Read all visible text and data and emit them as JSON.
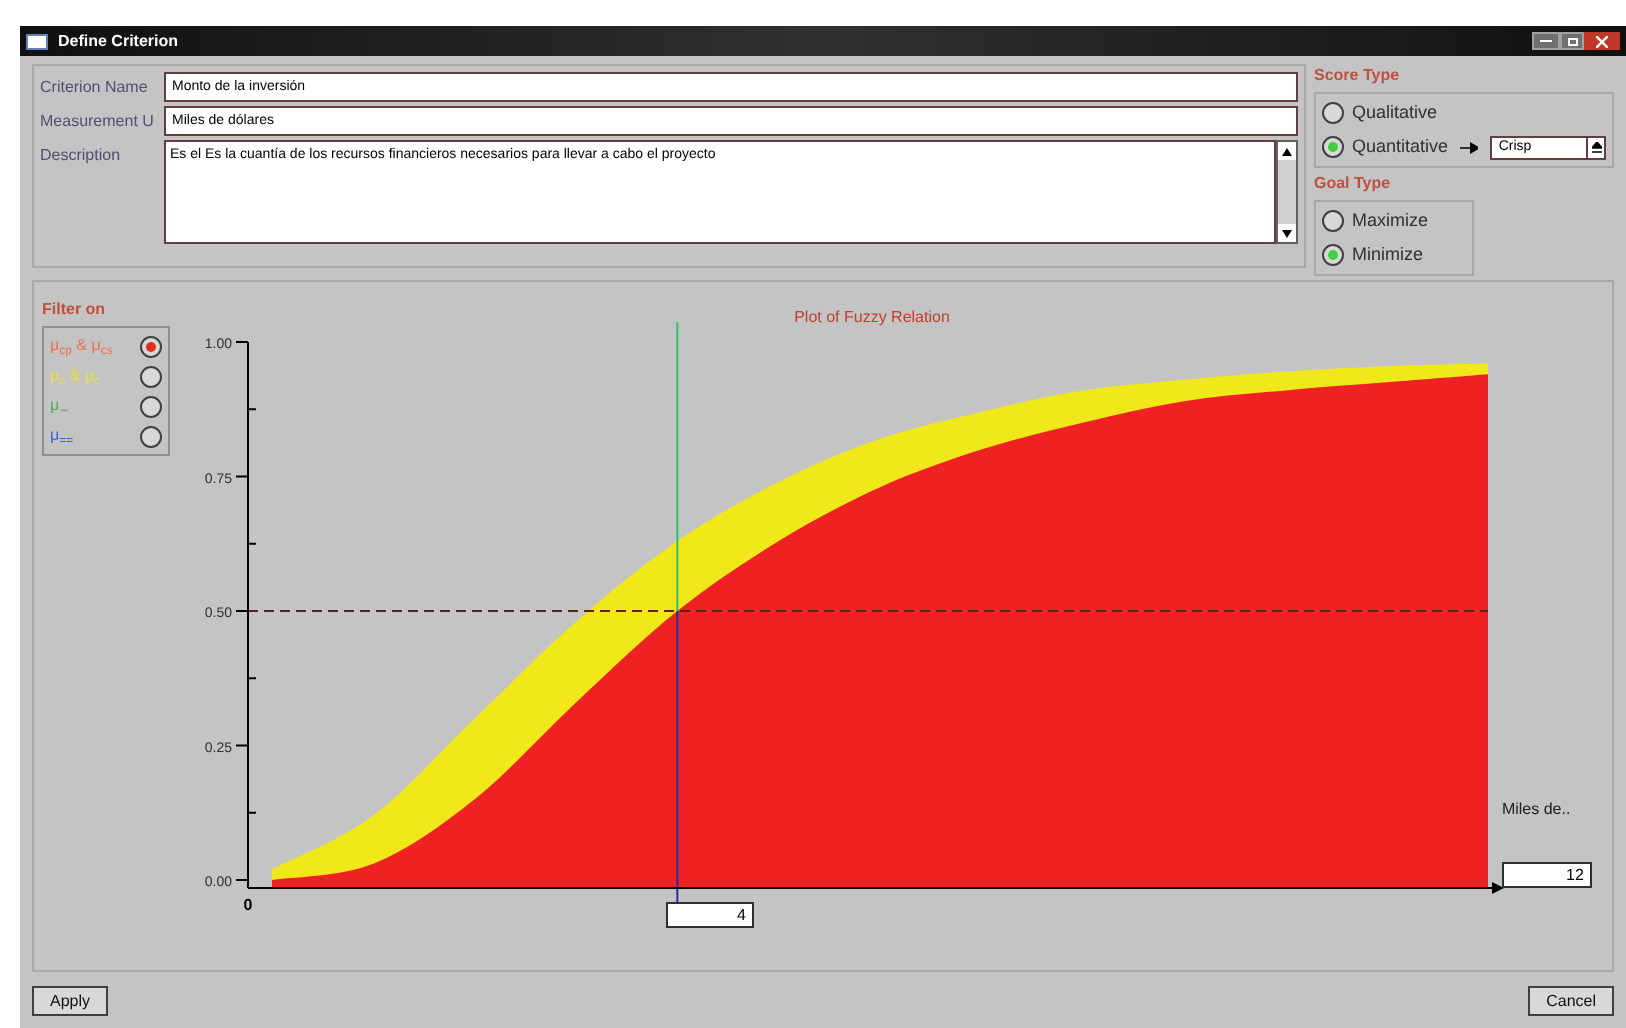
{
  "window": {
    "title": "Define Criterion"
  },
  "fields": [
    {
      "label": "Criterion Name",
      "value": "Monto de la inversión",
      "kind": "input"
    },
    {
      "label": "Measurement U",
      "value": "Miles de dólares",
      "kind": "input"
    },
    {
      "label": "Description",
      "value": "Es el Es la cuantía de los recursos financieros necesarios para llevar a cabo el proyecto",
      "kind": "textarea"
    }
  ],
  "score_type": {
    "title": "Score Type",
    "options": [
      {
        "label": "Qualitative",
        "selected": false
      },
      {
        "label": "Quantitative",
        "selected": true
      }
    ],
    "select": {
      "value": "Crisp"
    }
  },
  "goal_type": {
    "title": "Goal Type",
    "options": [
      {
        "label": "Maximize",
        "selected": false
      },
      {
        "label": "Minimize",
        "selected": true
      }
    ]
  },
  "filter": {
    "title": "Filter on",
    "options": [
      {
        "label": "μ$_{cp}$ & μ$_{cs}$",
        "color": "#f07050",
        "selected": true
      },
      {
        "label": "μ$_{c}$ & μ$_{c}$",
        "color": "#e8e040",
        "selected": false
      },
      {
        "label": "μ$_{∼}$",
        "color": "#50b050",
        "selected": false
      },
      {
        "label": "μ$_{==}$",
        "color": "#4060d0",
        "selected": false
      }
    ]
  },
  "plot": {
    "title": "Plot of Fuzzy Relation",
    "y_tick_labels": [
      "1.00",
      "0.75",
      "0.50",
      "0.25",
      "0.00"
    ],
    "x_origin_label": "0",
    "unit_label": "Miles de..",
    "cursor_value": "4",
    "max_value": "12"
  },
  "buttons": [
    "Apply",
    "Cancel"
  ]
}
